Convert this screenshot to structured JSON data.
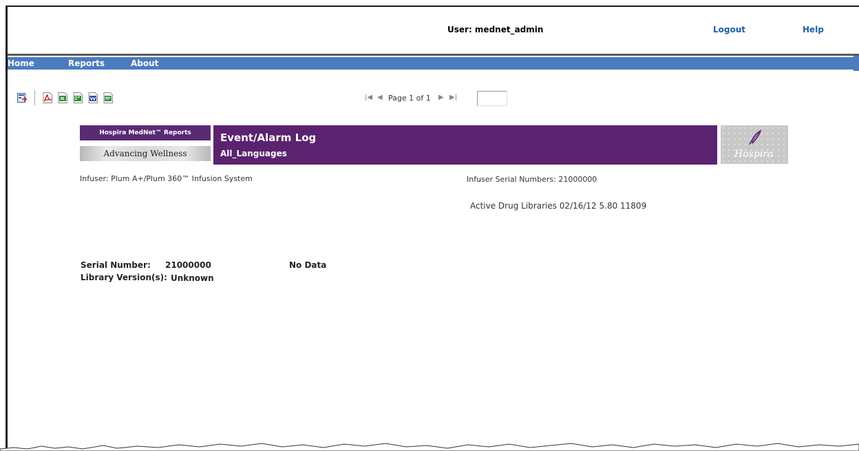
{
  "header": {
    "user_label": "User: mednet_admin",
    "logout": "Logout",
    "help": "Help"
  },
  "nav": {
    "items": [
      "Home",
      "Reports",
      "About"
    ]
  },
  "toolbar": {
    "icons": [
      "export-icon",
      "pdf-icon",
      "excel-icon",
      "excel-data-icon",
      "word-icon",
      "rtf-icon"
    ]
  },
  "pager": {
    "label": "Page 1 of 1",
    "input_value": ""
  },
  "report": {
    "brand_top": "Hospira MedNet™ Reports",
    "brand_bottom": "Advancing Wellness",
    "title": "Event/Alarm Log",
    "subtitle": "All_Languages",
    "logo_text": "Hospira",
    "infuser": "Infuser: Plum A+/Plum 360™ Infusion System",
    "serial_numbers": "Infuser Serial Numbers: 21000000",
    "active_libraries": "Active Drug Libraries 02/16/12 5.80 11809",
    "serial_label": "Serial Number:",
    "serial_value": "21000000",
    "no_data": "No Data",
    "library_label": "Library Version(s):",
    "library_value": "Unknown"
  },
  "colors": {
    "nav_bg": "#4a7cbf",
    "header_purple": "#5b2270",
    "link_blue": "#1a5fb4"
  }
}
